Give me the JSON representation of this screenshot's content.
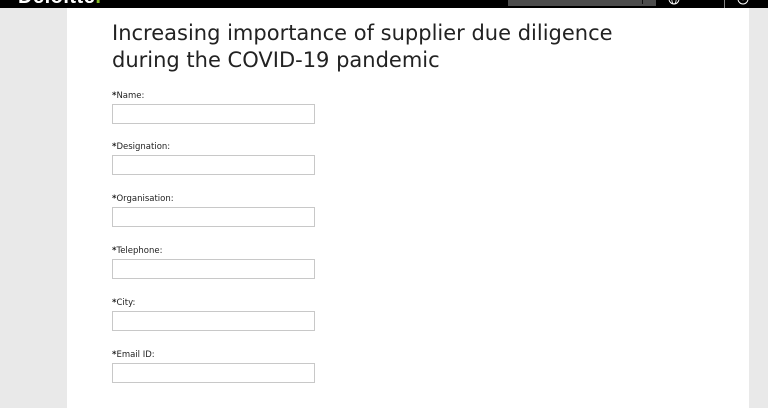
{
  "header": {
    "logo_text": "Deloitte",
    "logo_dot": ".",
    "brand_accent": "#86bc25",
    "search_icon": "search-icon",
    "globe_icon": "globe-icon",
    "user_icon": "user-icon"
  },
  "page": {
    "title": "Increasing importance of supplier due diligence during the COVID-19 pandemic"
  },
  "form": {
    "required_marker": "*",
    "fields": [
      {
        "label": "Name:",
        "value": ""
      },
      {
        "label": "Designation:",
        "value": ""
      },
      {
        "label": "Organisation:",
        "value": ""
      },
      {
        "label": "Telephone:",
        "value": ""
      },
      {
        "label": "City:",
        "value": ""
      },
      {
        "label": "Email ID:",
        "value": ""
      }
    ]
  }
}
